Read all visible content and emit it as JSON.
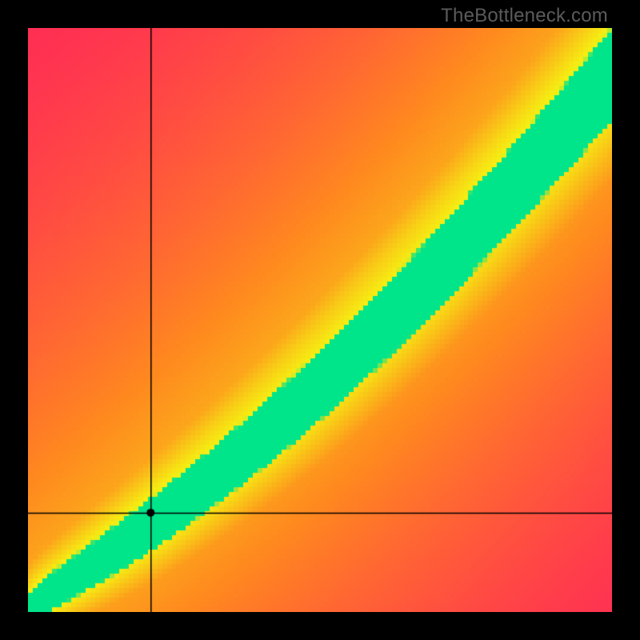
{
  "watermark": "TheBottleneck.com",
  "chart_data": {
    "type": "heatmap",
    "title": "",
    "xlabel": "",
    "ylabel": "",
    "xlim": [
      0,
      100
    ],
    "ylim": [
      0,
      100
    ],
    "grid": false,
    "legend": false,
    "point": {
      "x": 21,
      "y": 17
    },
    "crosshair": {
      "x": 21,
      "y": 17
    },
    "optimal_curve": {
      "start": [
        0,
        0
      ],
      "end": [
        100,
        92
      ],
      "shape": "slightly-convex"
    },
    "color_scale": {
      "best": "#00e48a",
      "good": "#f6f013",
      "mid": "#ff8a1f",
      "bad": "#ff2b56"
    },
    "description": "2D heatmap where color encodes match quality between two component scores. Bright green diagonal band marks balanced pairings; red corners mark severe bottlenecks. Black crosshair at (21,17) with a small black dot. Plot is inset inside a solid black border."
  }
}
